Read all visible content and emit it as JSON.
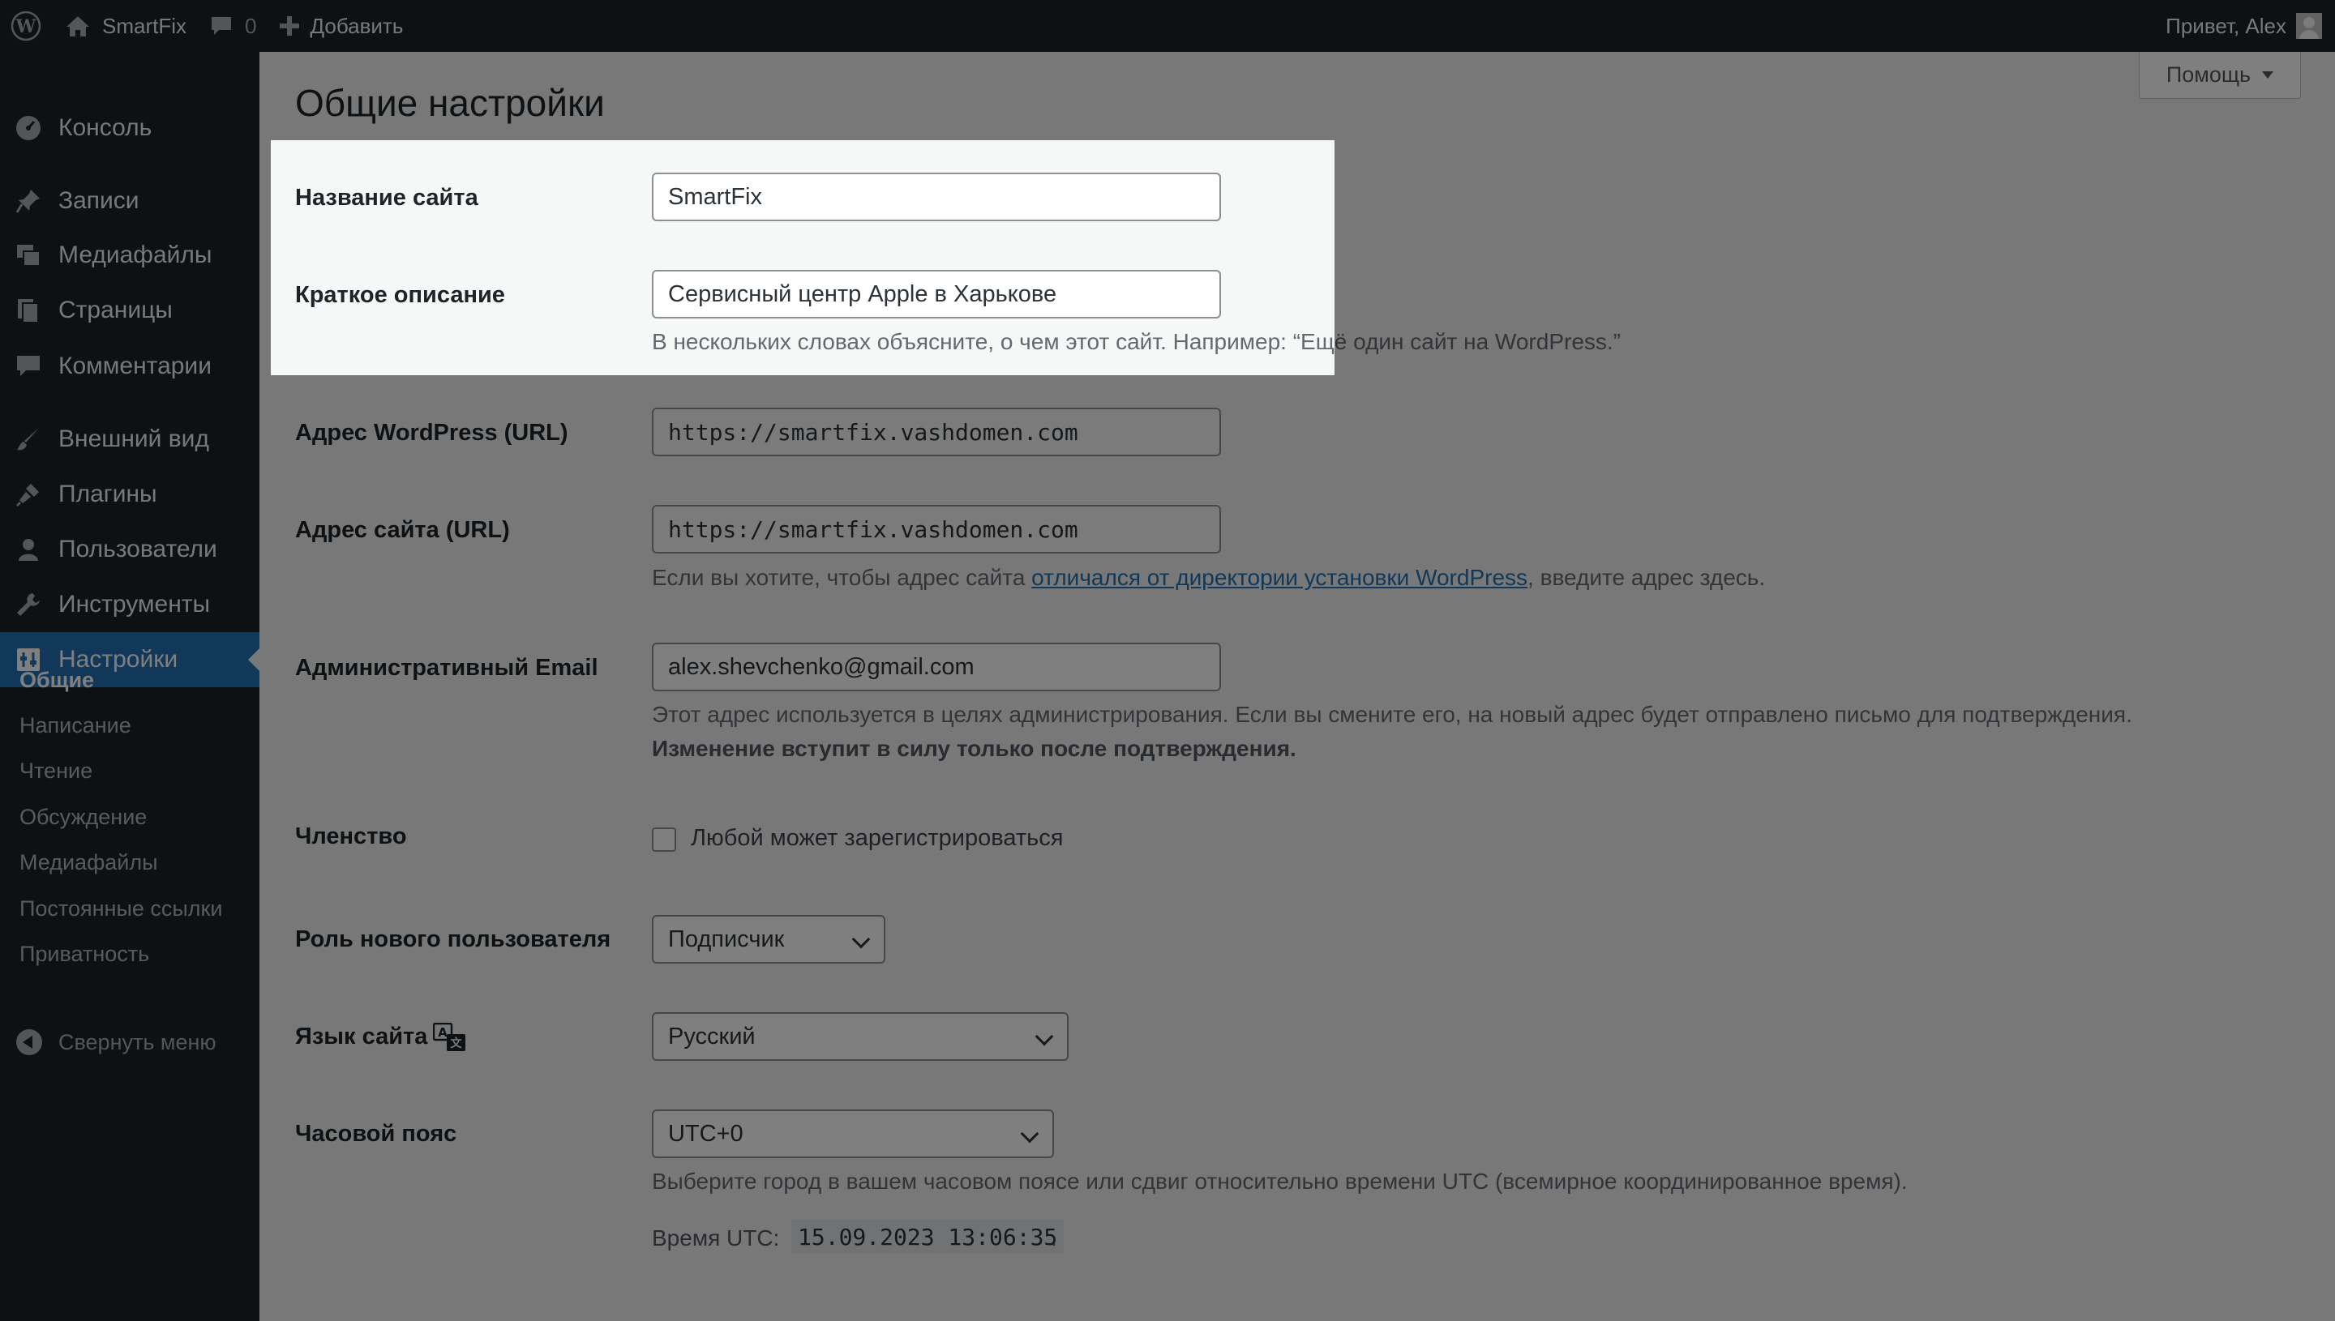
{
  "adminbar": {
    "site_name": "SmartFix",
    "comments_count": "0",
    "new_label": "Добавить",
    "greeting": "Привет, Alex"
  },
  "menu": {
    "items": [
      {
        "label": "Консоль",
        "icon": "dashboard-icon"
      },
      {
        "label": "Записи",
        "icon": "pushpin-icon"
      },
      {
        "label": "Медиафайлы",
        "icon": "media-icon"
      },
      {
        "label": "Страницы",
        "icon": "pages-icon"
      },
      {
        "label": "Комментарии",
        "icon": "comment-icon"
      },
      {
        "label": "Внешний вид",
        "icon": "brush-icon"
      },
      {
        "label": "Плагины",
        "icon": "plugin-icon"
      },
      {
        "label": "Пользователи",
        "icon": "users-icon"
      },
      {
        "label": "Инструменты",
        "icon": "wrench-icon"
      },
      {
        "label": "Настройки",
        "icon": "settings-icon"
      }
    ],
    "submenu": [
      "Общие",
      "Написание",
      "Чтение",
      "Обсуждение",
      "Медиафайлы",
      "Постоянные ссылки",
      "Приватность"
    ],
    "collapse_label": "Свернуть меню"
  },
  "help_label": "Помощь",
  "page_title": "Общие настройки",
  "settings": {
    "site_title": {
      "label": "Название сайта",
      "value": "SmartFix"
    },
    "tagline": {
      "label": "Краткое описание",
      "value": "Сервисный центр Apple в Харькове",
      "description": "В нескольких словах объясните, о чем этот сайт. Например: “Ещё один сайт на WordPress.”"
    },
    "wp_url": {
      "label": "Адрес WordPress (URL)",
      "value": "https://smartfix.vashdomen.com"
    },
    "site_url": {
      "label": "Адрес сайта (URL)",
      "value": "https://smartfix.vashdomen.com",
      "desc_before": "Если вы хотите, чтобы адрес сайта ",
      "desc_link": "отличался от директории установки WordPress",
      "desc_after": ", введите адрес здесь."
    },
    "admin_email": {
      "label": "Административный Email",
      "value": "alex.shevchenko@gmail.com",
      "description": "Этот адрес используется в целях администрирования. Если вы смените его, на новый адрес будет отправлено письмо для подтверждения.",
      "note": "Изменение вступит в силу только после подтверждения."
    },
    "membership": {
      "label": "Членство",
      "checkbox_label": "Любой может зарегистрироваться",
      "checked": false
    },
    "default_role": {
      "label": "Роль нового пользователя",
      "value": "Подписчик"
    },
    "language": {
      "label": "Язык сайта",
      "value": "Русский",
      "icon": "translation-icon"
    },
    "timezone": {
      "label": "Часовой пояс",
      "value": "UTC+0",
      "description": "Выберите город в вашем часовом поясе или сдвиг относительно времени UTC (всемирное координированное время).",
      "utc_label": "Время UTC:",
      "utc_time": "15.09.2023 13:06:35",
      "utc_suffix": "."
    }
  },
  "colors": {
    "accent": "#2271b1",
    "sidebar": "#1d2327",
    "background": "#f0f0f1"
  }
}
